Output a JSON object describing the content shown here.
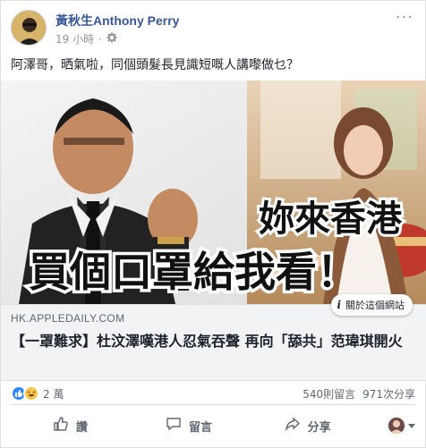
{
  "post": {
    "author": "黃秋生Anthony Perry",
    "time": "19 小時",
    "text": "阿澤哥，晒氣啦，同個頭髮長見識短嘅人講嚟做乜？"
  },
  "link": {
    "image_caption_line1": "妳來香港",
    "image_caption_line2": "買個口罩給我看！",
    "about_label": "關於這個網站",
    "domain": "HK.APPLEDAILY.COM",
    "headline": "【一罩難求】杜汶澤嘆港人忍氣吞聲 再向「舔共」范瑋琪開火"
  },
  "stats": {
    "reactions": "2 萬",
    "comments": "540則留言",
    "shares": "971次分享"
  },
  "actions": {
    "like": "讚",
    "comment": "留言",
    "share": "分享"
  },
  "colors": {
    "author_link": "#365899",
    "like_blue": "#2d88ff",
    "haha_yellow": "#f7c548"
  }
}
